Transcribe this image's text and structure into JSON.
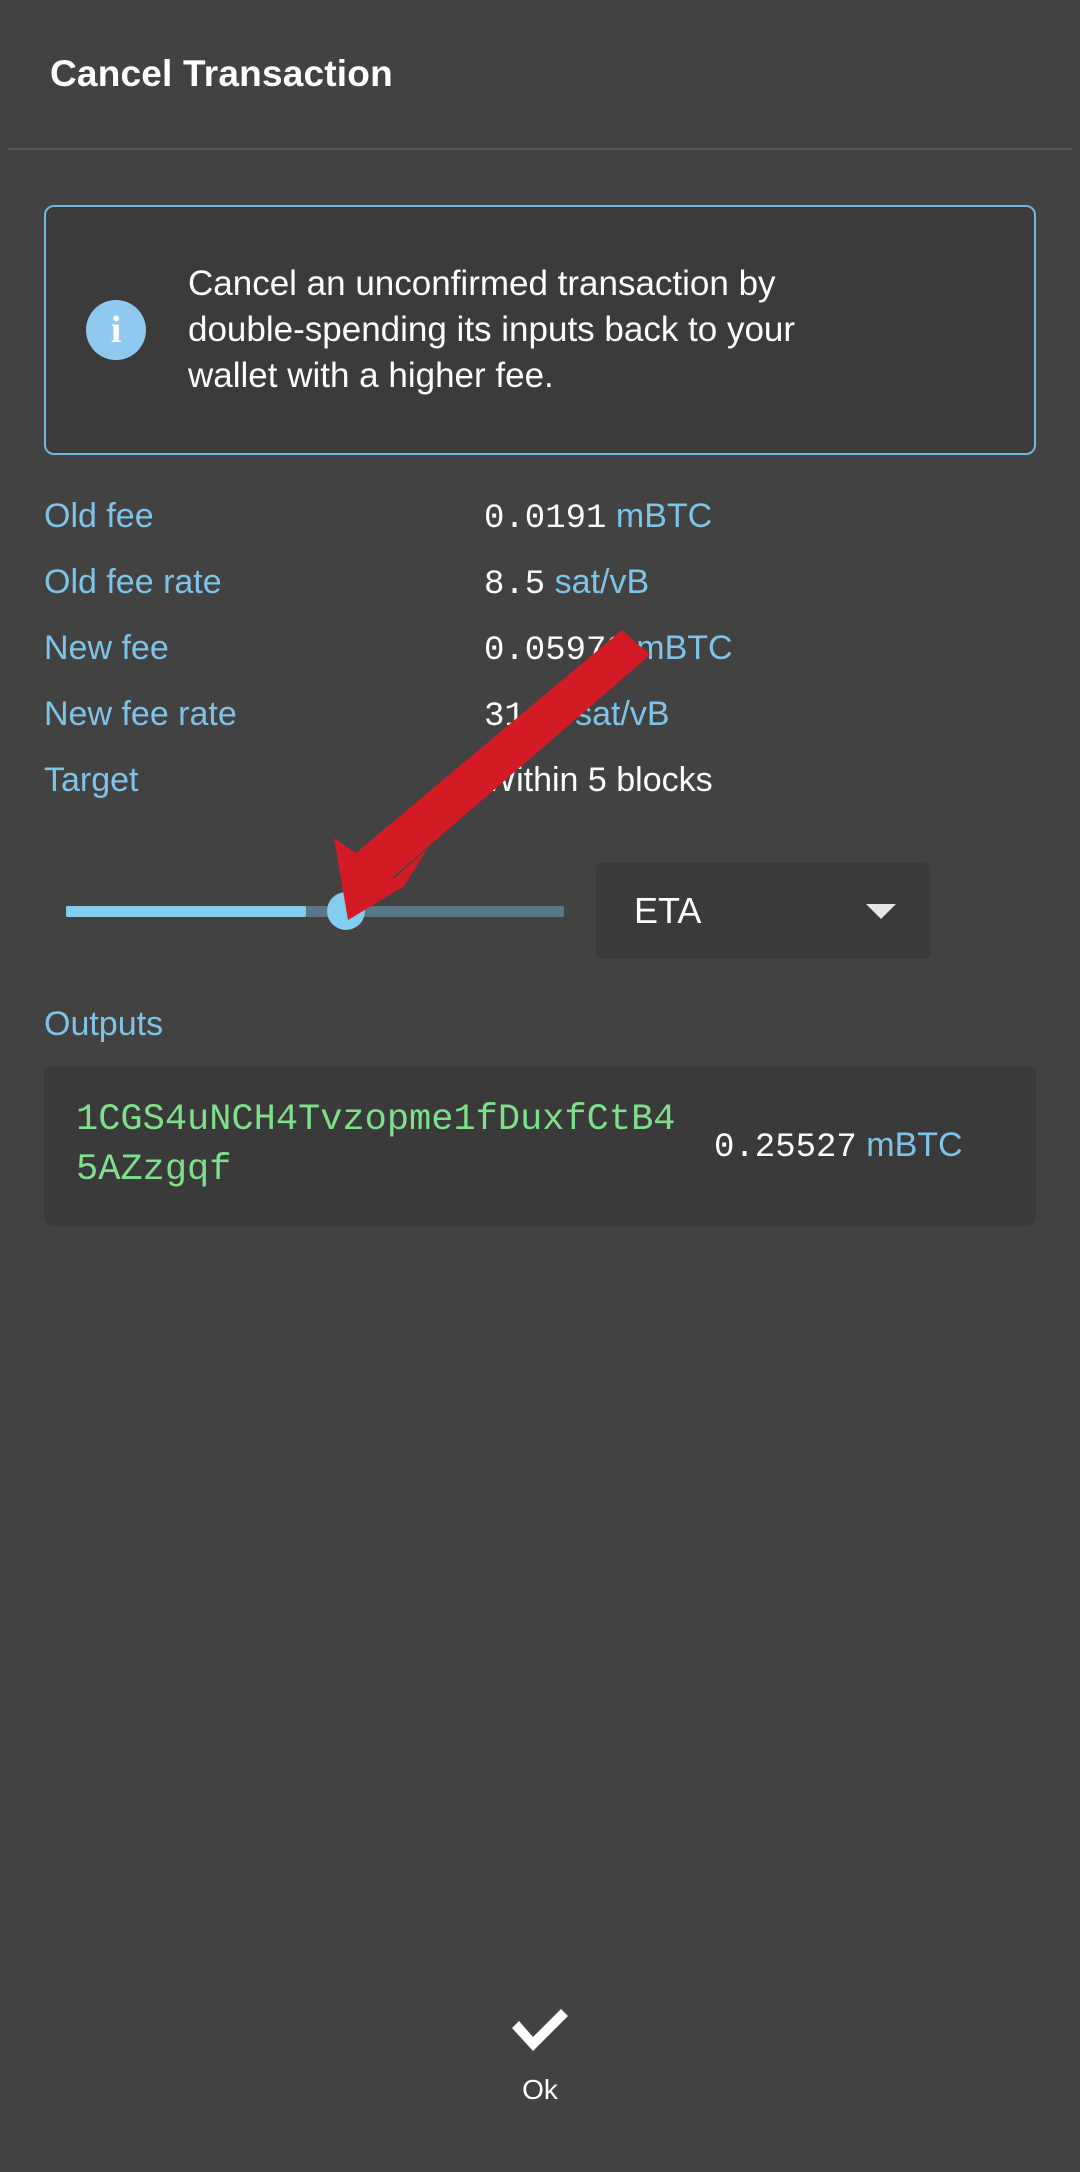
{
  "window": {
    "title": "Cancel Transaction"
  },
  "info": {
    "icon": "info-icon",
    "text": "Cancel an unconfirmed transaction by double-spending its inputs back to your wallet with a higher fee."
  },
  "details": {
    "rows": [
      {
        "label": "Old fee",
        "number": "0.0191",
        "unit": "mBTC",
        "style": "unit"
      },
      {
        "label": "Old fee rate",
        "number": "8.5",
        "unit": "sat/vB",
        "style": "unit"
      },
      {
        "label": "New fee",
        "number": "0.05972",
        "unit": "mBTC",
        "style": "unit"
      },
      {
        "label": "New fee rate",
        "number": "31.1",
        "unit": "sat/vB",
        "style": "unit"
      },
      {
        "label": "Target",
        "number": "Within 5 blocks",
        "unit": "",
        "style": "plain"
      }
    ]
  },
  "fee_slider": {
    "value_percent": 50,
    "min_percent": 0,
    "max_percent": 100
  },
  "target_mode": {
    "selected": "ETA",
    "chevron": "chevron-down-icon"
  },
  "outputs": {
    "heading": "Outputs",
    "items": [
      {
        "address": "1CGS4uNCH4Tvzopme1fDuxfCtB45AZzgqf",
        "amount": "0.25527",
        "unit": "mBTC"
      }
    ]
  },
  "footer": {
    "ok_label": "Ok",
    "ok_icon": "check-icon"
  },
  "annotation": {
    "type": "red-arrow",
    "points_to": "fee-slider-thumb",
    "color": "#d31b26"
  },
  "colors": {
    "background": "#424242",
    "accent_blue": "#7ec3e8",
    "address_green": "#7ee08a",
    "slider_fill": "#83cdf0",
    "slider_rest": "#5b7684",
    "info_border": "#6fb8dd",
    "arrow_red": "#d31b26"
  }
}
